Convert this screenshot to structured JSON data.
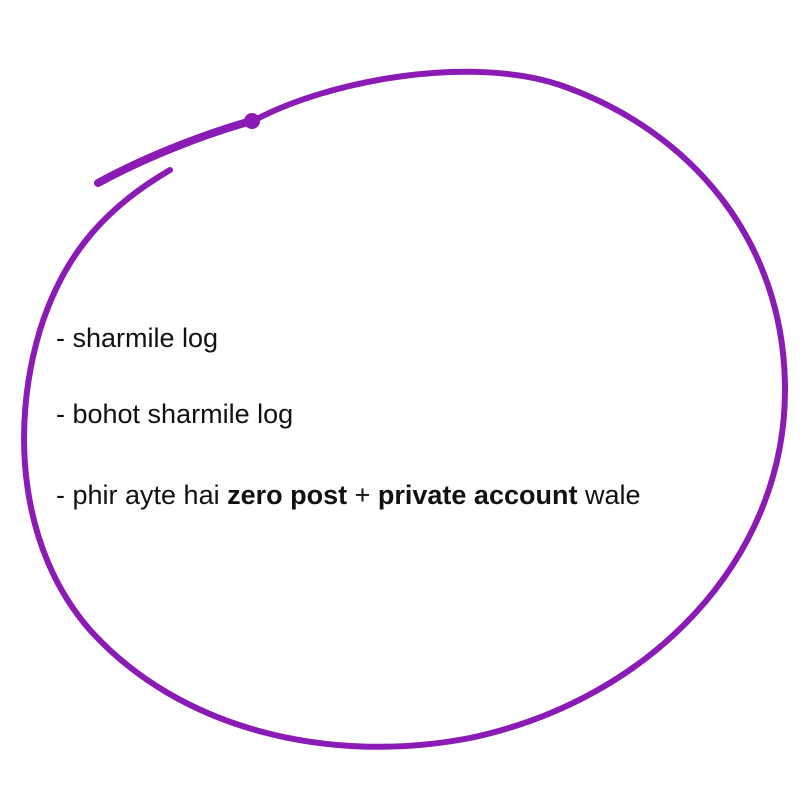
{
  "colors": {
    "background": "#ffffff",
    "circle_stroke": "#8a1bb5",
    "text": "#111111"
  },
  "lines": [
    {
      "text": "- sharmile log"
    },
    {
      "text": "- bohot sharmile log"
    },
    {
      "prefix": "- phir ayte hai ",
      "bold1": "zero post",
      "middle": " + ",
      "bold2": "private account",
      "suffix": " wale"
    }
  ]
}
